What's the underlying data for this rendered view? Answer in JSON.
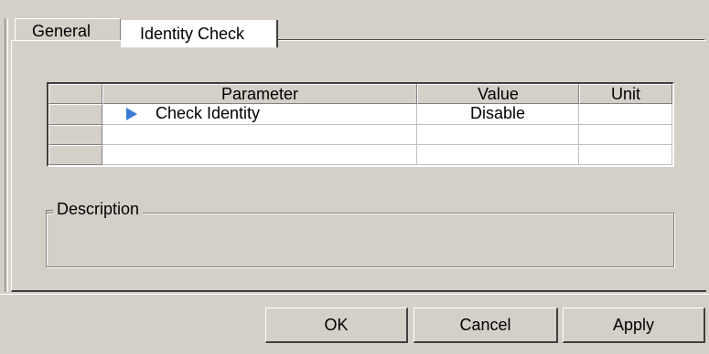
{
  "tabs": [
    {
      "label": "General",
      "active": false
    },
    {
      "label": "Identity Check",
      "active": true
    }
  ],
  "grid": {
    "columns": [
      "Parameter",
      "Value",
      "Unit"
    ],
    "rows": [
      {
        "parameter": "Check Identity",
        "value": "Disable",
        "unit": "",
        "icon": "expand-arrow-icon"
      },
      {
        "parameter": "",
        "value": "",
        "unit": ""
      },
      {
        "parameter": "",
        "value": "",
        "unit": ""
      }
    ]
  },
  "description": {
    "label": "Description",
    "text": ""
  },
  "buttons": {
    "ok": "OK",
    "cancel": "Cancel",
    "apply": "Apply"
  },
  "colors": {
    "background": "#d4d0c8",
    "accent_icon": "#3a7bd5"
  }
}
